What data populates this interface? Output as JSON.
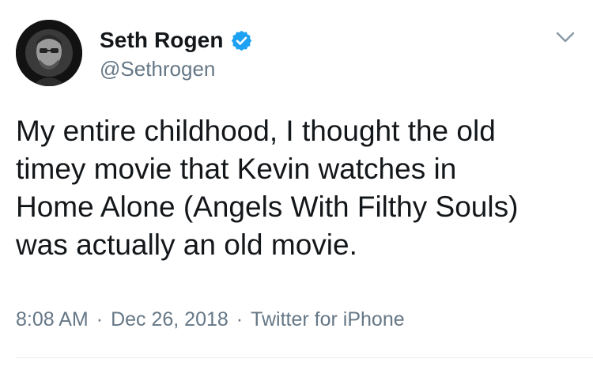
{
  "author": {
    "display_name": "Seth Rogen",
    "handle": "@Sethrogen",
    "verified": true
  },
  "tweet": {
    "text": "My entire childhood, I thought the old\ntimey movie that Kevin watches in\nHome Alone (Angels With Filthy Souls)\nwas actually an old movie."
  },
  "meta": {
    "time": "8:08 AM",
    "separator": "·",
    "date": "Dec 26, 2018",
    "source": "Twitter for iPhone"
  },
  "icons": {
    "verified": "verified-badge-icon",
    "menu": "chevron-down-icon"
  },
  "colors": {
    "verified_blue": "#1da1f2",
    "secondary_text": "#657786",
    "primary_text": "#14171a"
  }
}
